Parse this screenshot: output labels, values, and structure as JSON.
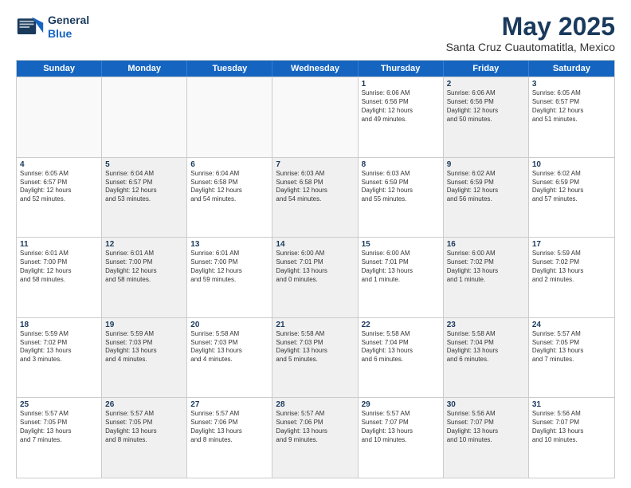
{
  "logo": {
    "line1": "General",
    "line2": "Blue"
  },
  "header": {
    "month": "May 2025",
    "location": "Santa Cruz Cuautomatitla, Mexico"
  },
  "days_of_week": [
    "Sunday",
    "Monday",
    "Tuesday",
    "Wednesday",
    "Thursday",
    "Friday",
    "Saturday"
  ],
  "weeks": [
    [
      {
        "day": "",
        "text": "",
        "shaded": false,
        "empty": true
      },
      {
        "day": "",
        "text": "",
        "shaded": false,
        "empty": true
      },
      {
        "day": "",
        "text": "",
        "shaded": false,
        "empty": true
      },
      {
        "day": "",
        "text": "",
        "shaded": false,
        "empty": true
      },
      {
        "day": "1",
        "text": "Sunrise: 6:06 AM\nSunset: 6:56 PM\nDaylight: 12 hours\nand 49 minutes.",
        "shaded": false,
        "empty": false
      },
      {
        "day": "2",
        "text": "Sunrise: 6:06 AM\nSunset: 6:56 PM\nDaylight: 12 hours\nand 50 minutes.",
        "shaded": true,
        "empty": false
      },
      {
        "day": "3",
        "text": "Sunrise: 6:05 AM\nSunset: 6:57 PM\nDaylight: 12 hours\nand 51 minutes.",
        "shaded": false,
        "empty": false
      }
    ],
    [
      {
        "day": "4",
        "text": "Sunrise: 6:05 AM\nSunset: 6:57 PM\nDaylight: 12 hours\nand 52 minutes.",
        "shaded": false,
        "empty": false
      },
      {
        "day": "5",
        "text": "Sunrise: 6:04 AM\nSunset: 6:57 PM\nDaylight: 12 hours\nand 53 minutes.",
        "shaded": true,
        "empty": false
      },
      {
        "day": "6",
        "text": "Sunrise: 6:04 AM\nSunset: 6:58 PM\nDaylight: 12 hours\nand 54 minutes.",
        "shaded": false,
        "empty": false
      },
      {
        "day": "7",
        "text": "Sunrise: 6:03 AM\nSunset: 6:58 PM\nDaylight: 12 hours\nand 54 minutes.",
        "shaded": true,
        "empty": false
      },
      {
        "day": "8",
        "text": "Sunrise: 6:03 AM\nSunset: 6:59 PM\nDaylight: 12 hours\nand 55 minutes.",
        "shaded": false,
        "empty": false
      },
      {
        "day": "9",
        "text": "Sunrise: 6:02 AM\nSunset: 6:59 PM\nDaylight: 12 hours\nand 56 minutes.",
        "shaded": true,
        "empty": false
      },
      {
        "day": "10",
        "text": "Sunrise: 6:02 AM\nSunset: 6:59 PM\nDaylight: 12 hours\nand 57 minutes.",
        "shaded": false,
        "empty": false
      }
    ],
    [
      {
        "day": "11",
        "text": "Sunrise: 6:01 AM\nSunset: 7:00 PM\nDaylight: 12 hours\nand 58 minutes.",
        "shaded": false,
        "empty": false
      },
      {
        "day": "12",
        "text": "Sunrise: 6:01 AM\nSunset: 7:00 PM\nDaylight: 12 hours\nand 58 minutes.",
        "shaded": true,
        "empty": false
      },
      {
        "day": "13",
        "text": "Sunrise: 6:01 AM\nSunset: 7:00 PM\nDaylight: 12 hours\nand 59 minutes.",
        "shaded": false,
        "empty": false
      },
      {
        "day": "14",
        "text": "Sunrise: 6:00 AM\nSunset: 7:01 PM\nDaylight: 13 hours\nand 0 minutes.",
        "shaded": true,
        "empty": false
      },
      {
        "day": "15",
        "text": "Sunrise: 6:00 AM\nSunset: 7:01 PM\nDaylight: 13 hours\nand 1 minute.",
        "shaded": false,
        "empty": false
      },
      {
        "day": "16",
        "text": "Sunrise: 6:00 AM\nSunset: 7:02 PM\nDaylight: 13 hours\nand 1 minute.",
        "shaded": true,
        "empty": false
      },
      {
        "day": "17",
        "text": "Sunrise: 5:59 AM\nSunset: 7:02 PM\nDaylight: 13 hours\nand 2 minutes.",
        "shaded": false,
        "empty": false
      }
    ],
    [
      {
        "day": "18",
        "text": "Sunrise: 5:59 AM\nSunset: 7:02 PM\nDaylight: 13 hours\nand 3 minutes.",
        "shaded": false,
        "empty": false
      },
      {
        "day": "19",
        "text": "Sunrise: 5:59 AM\nSunset: 7:03 PM\nDaylight: 13 hours\nand 4 minutes.",
        "shaded": true,
        "empty": false
      },
      {
        "day": "20",
        "text": "Sunrise: 5:58 AM\nSunset: 7:03 PM\nDaylight: 13 hours\nand 4 minutes.",
        "shaded": false,
        "empty": false
      },
      {
        "day": "21",
        "text": "Sunrise: 5:58 AM\nSunset: 7:03 PM\nDaylight: 13 hours\nand 5 minutes.",
        "shaded": true,
        "empty": false
      },
      {
        "day": "22",
        "text": "Sunrise: 5:58 AM\nSunset: 7:04 PM\nDaylight: 13 hours\nand 6 minutes.",
        "shaded": false,
        "empty": false
      },
      {
        "day": "23",
        "text": "Sunrise: 5:58 AM\nSunset: 7:04 PM\nDaylight: 13 hours\nand 6 minutes.",
        "shaded": true,
        "empty": false
      },
      {
        "day": "24",
        "text": "Sunrise: 5:57 AM\nSunset: 7:05 PM\nDaylight: 13 hours\nand 7 minutes.",
        "shaded": false,
        "empty": false
      }
    ],
    [
      {
        "day": "25",
        "text": "Sunrise: 5:57 AM\nSunset: 7:05 PM\nDaylight: 13 hours\nand 7 minutes.",
        "shaded": false,
        "empty": false
      },
      {
        "day": "26",
        "text": "Sunrise: 5:57 AM\nSunset: 7:05 PM\nDaylight: 13 hours\nand 8 minutes.",
        "shaded": true,
        "empty": false
      },
      {
        "day": "27",
        "text": "Sunrise: 5:57 AM\nSunset: 7:06 PM\nDaylight: 13 hours\nand 8 minutes.",
        "shaded": false,
        "empty": false
      },
      {
        "day": "28",
        "text": "Sunrise: 5:57 AM\nSunset: 7:06 PM\nDaylight: 13 hours\nand 9 minutes.",
        "shaded": true,
        "empty": false
      },
      {
        "day": "29",
        "text": "Sunrise: 5:57 AM\nSunset: 7:07 PM\nDaylight: 13 hours\nand 10 minutes.",
        "shaded": false,
        "empty": false
      },
      {
        "day": "30",
        "text": "Sunrise: 5:56 AM\nSunset: 7:07 PM\nDaylight: 13 hours\nand 10 minutes.",
        "shaded": true,
        "empty": false
      },
      {
        "day": "31",
        "text": "Sunrise: 5:56 AM\nSunset: 7:07 PM\nDaylight: 13 hours\nand 10 minutes.",
        "shaded": false,
        "empty": false
      }
    ]
  ]
}
